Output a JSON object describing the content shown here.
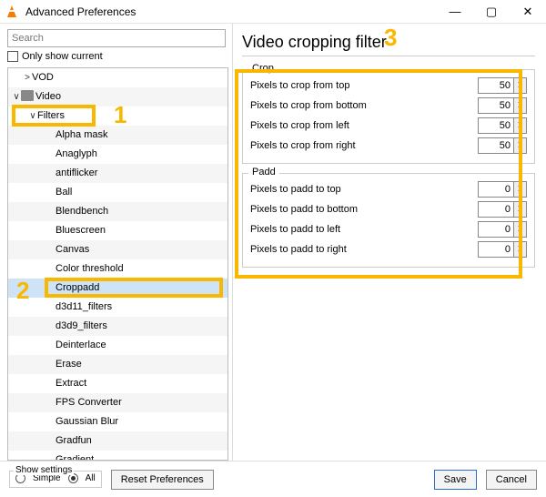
{
  "window": {
    "title": "Advanced Preferences",
    "buttons": {
      "min": "—",
      "max": "▢",
      "close": "✕"
    }
  },
  "left": {
    "search_placeholder": "Search",
    "only_current": "Only show current",
    "tree_top": [
      {
        "label": "VOD",
        "twisty": ">",
        "indent": 16,
        "icon": false
      },
      {
        "label": "Video",
        "twisty": "∨",
        "indent": 4,
        "icon": true
      },
      {
        "label": "Filters",
        "twisty": "∨",
        "indent": 22,
        "icon": false
      }
    ],
    "filters": [
      "Alpha mask",
      "Anaglyph",
      "antiflicker",
      "Ball",
      "Blendbench",
      "Bluescreen",
      "Canvas",
      "Color threshold",
      "Croppadd",
      "d3d11_filters",
      "d3d9_filters",
      "Deinterlace",
      "Erase",
      "Extract",
      "FPS Converter",
      "Gaussian Blur",
      "Gradfun",
      "Gradient"
    ],
    "selected_index": 8
  },
  "right": {
    "title": "Video cropping filter",
    "crop_legend": "Crop",
    "padd_legend": "Padd",
    "crop": [
      {
        "label": "Pixels to crop from top",
        "value": 50
      },
      {
        "label": "Pixels to crop from bottom",
        "value": 50
      },
      {
        "label": "Pixels to crop from left",
        "value": 50
      },
      {
        "label": "Pixels to crop from right",
        "value": 50
      }
    ],
    "padd": [
      {
        "label": "Pixels to padd to top",
        "value": 0
      },
      {
        "label": "Pixels to padd to bottom",
        "value": 0
      },
      {
        "label": "Pixels to padd to left",
        "value": 0
      },
      {
        "label": "Pixels to padd to right",
        "value": 0
      }
    ]
  },
  "footer": {
    "show_settings_legend": "Show settings",
    "radio_simple": "Simple",
    "radio_all": "All",
    "reset": "Reset Preferences",
    "save": "Save",
    "cancel": "Cancel"
  },
  "markers": {
    "one": "1",
    "two": "2",
    "three": "3"
  }
}
